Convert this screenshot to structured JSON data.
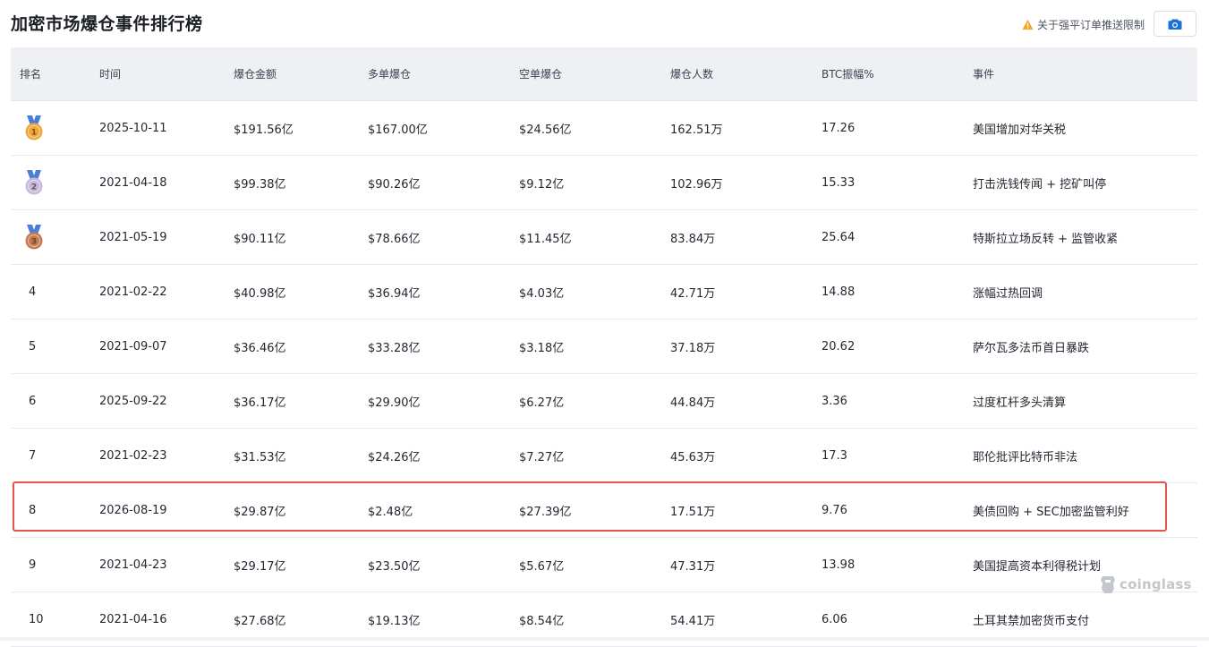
{
  "title": "加密市场爆仓事件排行榜",
  "notice_label": "关于强平订单推送限制",
  "colors": {
    "highlight": "#e9534f",
    "gold": "#f0a63a",
    "silver": "#c8b8de",
    "bronze": "#c47a51",
    "ribbon": "#4a7fd6"
  },
  "columns": [
    "排名",
    "时间",
    "爆仓金额",
    "多单爆仓",
    "空单爆仓",
    "爆仓人数",
    "BTC振幅%",
    "事件"
  ],
  "rows": [
    {
      "rank": "1",
      "date": "2025-10-11",
      "total": "$191.56亿",
      "long": "$167.00亿",
      "short": "$24.56亿",
      "people": "162.51万",
      "btc": "17.26",
      "event": "美国增加对华关税",
      "medal": "gold"
    },
    {
      "rank": "2",
      "date": "2021-04-18",
      "total": "$99.38亿",
      "long": "$90.26亿",
      "short": "$9.12亿",
      "people": "102.96万",
      "btc": "15.33",
      "event": "打击洗钱传闻 + 挖矿叫停",
      "medal": "silver"
    },
    {
      "rank": "3",
      "date": "2021-05-19",
      "total": "$90.11亿",
      "long": "$78.66亿",
      "short": "$11.45亿",
      "people": "83.84万",
      "btc": "25.64",
      "event": "特斯拉立场反转 + 监管收紧",
      "medal": "bronze"
    },
    {
      "rank": "4",
      "date": "2021-02-22",
      "total": "$40.98亿",
      "long": "$36.94亿",
      "short": "$4.03亿",
      "people": "42.71万",
      "btc": "14.88",
      "event": "涨幅过热回调"
    },
    {
      "rank": "5",
      "date": "2021-09-07",
      "total": "$36.46亿",
      "long": "$33.28亿",
      "short": "$3.18亿",
      "people": "37.18万",
      "btc": "20.62",
      "event": "萨尔瓦多法币首日暴跌"
    },
    {
      "rank": "6",
      "date": "2025-09-22",
      "total": "$36.17亿",
      "long": "$29.90亿",
      "short": "$6.27亿",
      "people": "44.84万",
      "btc": "3.36",
      "event": "过度杠杆多头清算"
    },
    {
      "rank": "7",
      "date": "2021-02-23",
      "total": "$31.53亿",
      "long": "$24.26亿",
      "short": "$7.27亿",
      "people": "45.63万",
      "btc": "17.3",
      "event": "耶伦批评比特币非法"
    },
    {
      "rank": "8",
      "date": "2026-08-19",
      "total": "$29.87亿",
      "long": "$2.48亿",
      "short": "$27.39亿",
      "people": "17.51万",
      "btc": "9.76",
      "event": "美债回购 + SEC加密监管利好",
      "highlighted": true
    },
    {
      "rank": "9",
      "date": "2021-04-23",
      "total": "$29.17亿",
      "long": "$23.50亿",
      "short": "$5.67亿",
      "people": "47.31万",
      "btc": "13.98",
      "event": "美国提高资本利得税计划"
    },
    {
      "rank": "10",
      "date": "2021-04-16",
      "total": "$27.68亿",
      "long": "$19.13亿",
      "short": "$8.54亿",
      "people": "54.41万",
      "btc": "6.06",
      "event": "土耳其禁加密货币支付"
    }
  ],
  "watermark": "coinglass"
}
